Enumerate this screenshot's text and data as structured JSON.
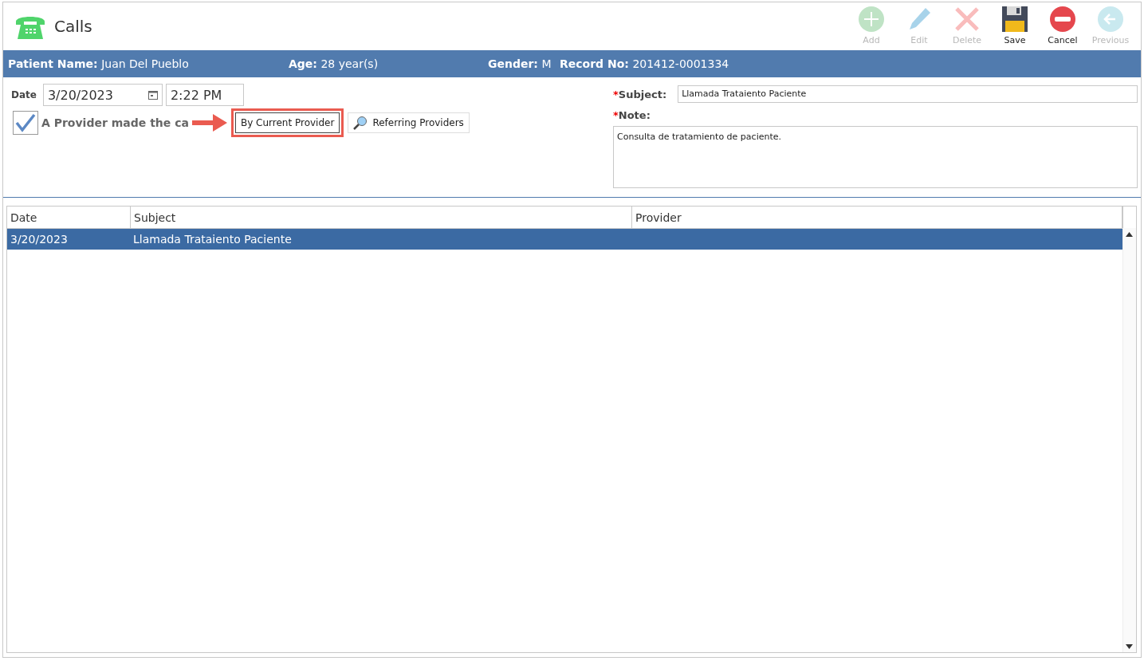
{
  "window": {
    "title": "Calls"
  },
  "toolbar": [
    {
      "kind": "add",
      "label": "Add",
      "disabled": true
    },
    {
      "kind": "edit",
      "label": "Edit",
      "disabled": true
    },
    {
      "kind": "delete",
      "label": "Delete",
      "disabled": true
    },
    {
      "kind": "save",
      "label": "Save",
      "disabled": false
    },
    {
      "kind": "cancel",
      "label": "Cancel",
      "disabled": false
    },
    {
      "kind": "previous",
      "label": "Previous",
      "disabled": true
    }
  ],
  "patient_bar": [
    {
      "label": "Patient Name:",
      "value": "Juan Del Pueblo"
    },
    {
      "label": "Age:",
      "value": "28 year(s)"
    },
    {
      "label": "Gender:",
      "value": "M"
    },
    {
      "label": "Record No:",
      "value": "201412-0001334"
    }
  ],
  "form": {
    "date_label": "Date",
    "date": "3/20/2023",
    "time": "2:22 PM",
    "provider_checkbox": {
      "label": "A Provider made the ca",
      "checked": true
    },
    "buttons": [
      {
        "kind": "plain",
        "label": "By Current Provider",
        "highlighted": true
      },
      {
        "kind": "search",
        "label": "Referring Providers",
        "highlighted": false
      }
    ],
    "required_mark": "*",
    "subject_label": "Subject:",
    "subject": "Llamada Trataiento Paciente",
    "note_label": "Note:",
    "note": "Consulta de tratamiento de paciente."
  },
  "table": {
    "columns": [
      "Date",
      "Subject",
      "Provider"
    ],
    "rows": [
      {
        "cells": [
          "3/20/2023",
          "Llamada Trataiento Paciente",
          ""
        ],
        "selected": true
      }
    ]
  }
}
